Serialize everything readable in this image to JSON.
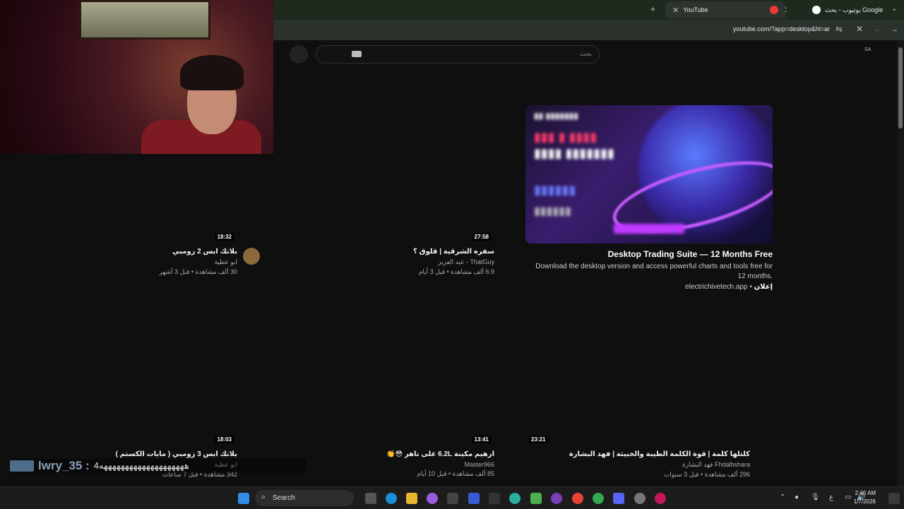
{
  "browser": {
    "tabs": [
      {
        "label": "يوتيوب - بحث Google",
        "active": false
      },
      {
        "label": "YouTube",
        "active": true
      }
    ],
    "new_tab": "+",
    "url": "youtube.com/?app=desktop&hl=ar"
  },
  "youtube": {
    "search_placeholder": "بحث",
    "region": "SA"
  },
  "ad": {
    "title": "Desktop Trading Suite — 12 Months Free",
    "description": "Download the desktop version and access powerful charts and tools free for 12 months.",
    "domain": "electrichivetech.app",
    "label": "إعلان"
  },
  "videos": [
    {
      "title": "سفره الشرقية | قلوق ؟",
      "channel": "ThatGuy - عبد العزيز",
      "stats": "6.9 ألف مشاهدة • قبل 3 أيام",
      "duration": "27:58"
    },
    {
      "title": "بلانك ابس 2 زومبي",
      "channel": "ابو عطية",
      "stats": "30 ألف مشاهدة • قبل 3 أشهر",
      "duration": "18:32"
    },
    {
      "title": "كلتلها كلمة | قوة الكلمة الطيبة والخبيثة | فهد البشارة",
      "channel": "Fhdalbshara فهد البشارة",
      "stats": "296 ألف مشاهدة • قبل 3 سنوات",
      "duration": "23:21"
    },
    {
      "title": "ارهيم مكينة 6.2L على ناهر 😳👏",
      "channel": "Master966",
      "stats": "85 ألف مشاهدة • قبل 10 أيام",
      "duration": "13:41"
    },
    {
      "title": "بلانك ابس 3 زومبي ( مابات الكستم )",
      "channel": "ابو عطية",
      "stats": "342 مشاهدة • قبل 7 ساعات",
      "duration": "18:03"
    }
  ],
  "chat_overlay": {
    "user": "lwry_35 :",
    "message": "4ههههههههههههههههههههه"
  },
  "taskbar": {
    "search_label": "Search",
    "time": "2:46 AM",
    "date": "1/7/2026",
    "lang": "ع"
  }
}
